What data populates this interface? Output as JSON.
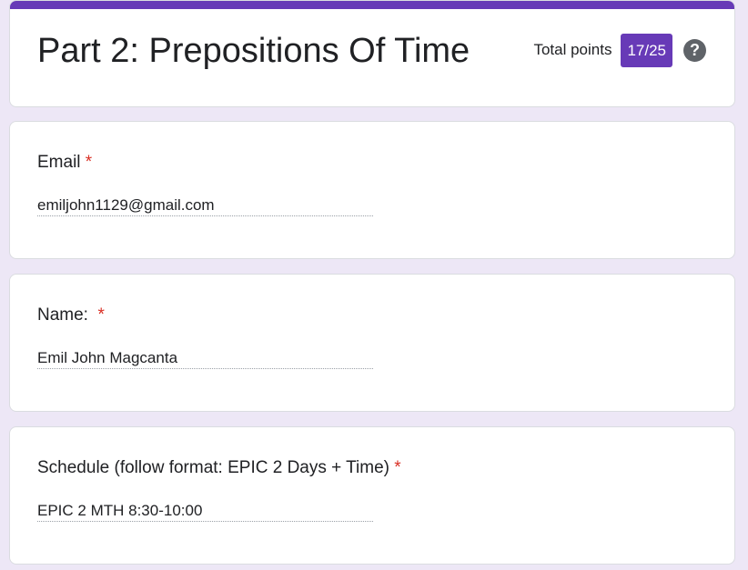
{
  "form": {
    "title": "Part 2: Prepositions Of Time",
    "total_points_label": "Total points",
    "score": "17/25",
    "help_glyph": "?",
    "accent_color": "#673ab7",
    "required_color": "#d93025"
  },
  "questions": [
    {
      "label": "Email",
      "required_mark": "*",
      "answer": "emiljohn1129@gmail.com"
    },
    {
      "label": "Name:  ",
      "required_mark": "*",
      "answer": "Emil John Magcanta"
    },
    {
      "label": "Schedule (follow format: EPIC 2 Days + Time) ",
      "required_mark": "*",
      "answer": "EPIC 2 MTH 8:30-10:00"
    }
  ],
  "icons": {
    "help": "help-circle-icon"
  }
}
